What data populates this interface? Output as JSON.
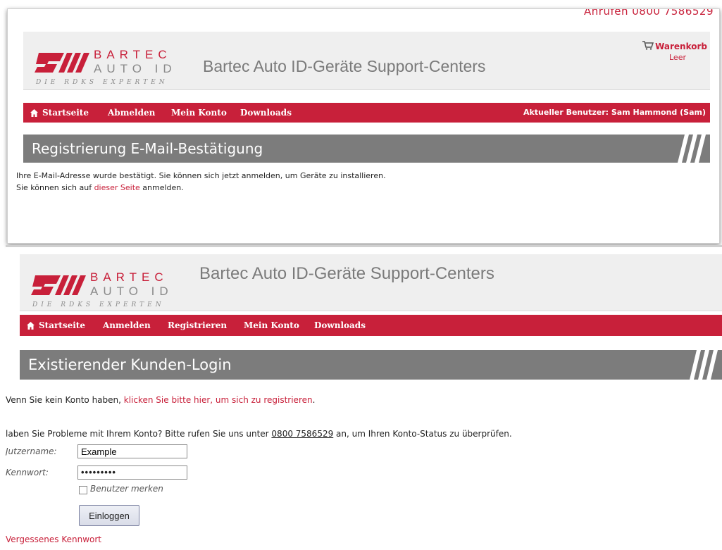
{
  "brand": {
    "name_top": "BARTEC",
    "name_bottom": "AUTO ID",
    "tagline": "DIE RDKS EXPERTEN"
  },
  "site_title": "Bartec Auto ID-Geräte Support-Centers",
  "colors": {
    "accent": "#c8203a",
    "section_bar": "#7c7c7c",
    "header_bg": "#efefef"
  },
  "panel1": {
    "phone_cut": "Anrufen 0800 7586529",
    "cart": {
      "label": "Warenkorb",
      "status": "Leer",
      "icon": "cart-icon"
    },
    "nav": {
      "home": "Startseite",
      "items": [
        "Abmelden",
        "Mein Konto",
        "Downloads"
      ],
      "current_user": "Aktueller Benutzer: Sam Hammond (Sam)"
    },
    "section_title": "Registrierung E-Mail-Bestätigung",
    "line1": "Ihre E-Mail-Adresse wurde bestätigt. Sie können sich jetzt anmelden, um Geräte zu installieren.",
    "line2_pre": "Sie können sich auf ",
    "line2_link": "dieser Seite",
    "line2_post": " anmelden."
  },
  "panel2": {
    "nav": {
      "home": "Startseite",
      "items": [
        "Anmelden",
        "Registrieren",
        "Mein Konto",
        "Downloads"
      ]
    },
    "section_title": "Existierender Kunden-Login",
    "register_pre": "Venn Sie kein Konto haben, ",
    "register_link": "klicken Sie bitte hier, um sich zu registrieren",
    "register_post": ".",
    "problems_pre": "laben Sie Probleme mit Ihrem Konto? Bitte rufen Sie uns unter ",
    "problems_phone": "0800 7586529",
    "problems_post": " an, um Ihren Konto-Status zu überprüfen.",
    "username_label": "Jutzername:",
    "username_value": "Example",
    "password_label": "Kennwort:",
    "password_value": "•••••••••",
    "remember_label": "Benutzer merken",
    "login_button": "Einloggen",
    "forgot_link": "Vergessenes Kennwort"
  }
}
